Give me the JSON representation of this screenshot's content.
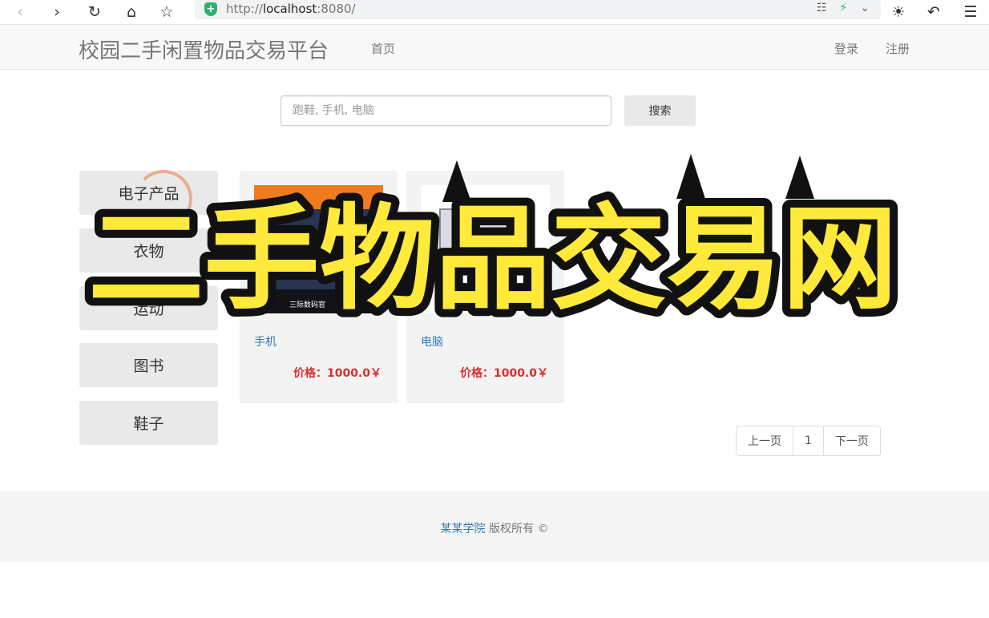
{
  "browser": {
    "url": "http://localhost:8080/",
    "url_host": "localhost",
    "url_scheme": "http://",
    "url_port_path": ":8080/"
  },
  "navbar": {
    "brand": "校园二手闲置物品交易平台",
    "home": "首页",
    "login": "登录",
    "register": "注册"
  },
  "search": {
    "placeholder": "跑鞋, 手机, 电脑",
    "button": "搜索"
  },
  "categories": [
    "电子产品",
    "衣物",
    "运动",
    "图书",
    "鞋子"
  ],
  "products": [
    {
      "name": "手机",
      "price": "价格：1000.0￥",
      "thumb_text": "三际数码官"
    },
    {
      "name": "电脑",
      "price": "价格：1000.0￥"
    }
  ],
  "pagination": {
    "prev": "上一页",
    "current": "1",
    "next": "下一页"
  },
  "footer": {
    "school": "某某学院",
    "rights": "版权所有 ©"
  },
  "overlay": {
    "title": "二手物品交易网",
    "fill_color": "#ffe93a",
    "stroke_color": "#111111"
  }
}
